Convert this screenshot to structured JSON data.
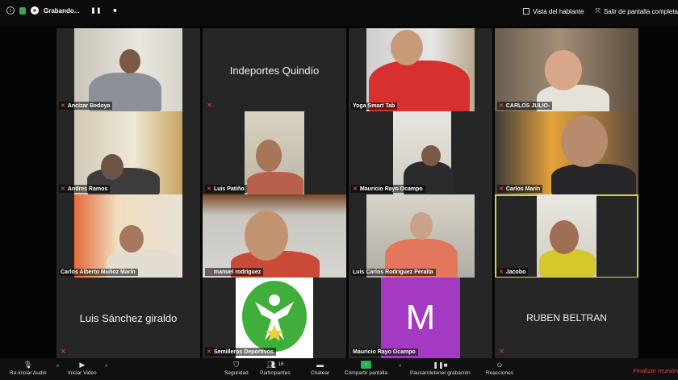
{
  "topbar": {
    "recording_label": "Grabando...",
    "pause_icon": "pause-icon",
    "stop_icon": "stop-icon",
    "speaker_view": "Vista del hablante",
    "exit_fullscreen": "Salir de pantalla completa"
  },
  "tiles": [
    {
      "label": "Ancízar Bedoya"
    },
    {
      "big": "Indeportes Quindío"
    },
    {
      "label": "Yoga Smart Tab"
    },
    {
      "label": "CARLOS JULIO-"
    },
    {
      "label": "Andres Ramos"
    },
    {
      "label": "Luis Patiño"
    },
    {
      "label": "Mauricio Rayo Ocampo"
    },
    {
      "label": "Carlos Marín"
    },
    {
      "label": "Carlos Alberto Muñoz Marín"
    },
    {
      "label": "manuel rodriguez"
    },
    {
      "label": "Luis Carlos Rodríguez Peralta"
    },
    {
      "label": "Jacobo"
    },
    {
      "big": "Luis Sánchez giraldo"
    },
    {
      "label": "Semilleros Deportivos"
    },
    {
      "label": "Mauricio Rayo Ocampo",
      "avatar_letter": "M"
    },
    {
      "big": "RUBEN BELTRAN"
    }
  ],
  "bottombar": {
    "audio": "Re-iniciar Audio",
    "video": "Iniciar Video",
    "security": "Seguridad",
    "participants": "Participantes",
    "participants_count": "16",
    "chat": "Chatear",
    "share": "Compartir pantalla",
    "record": "Pausar/detener grabación",
    "reactions": "Reacciones",
    "end": "Finalizar reunión"
  },
  "colors": {
    "background": "#050505",
    "tile": "#262626",
    "active_border": "#c9d64a",
    "muted": "#e4473c",
    "avatar_purple": "#a43ac1",
    "share_green": "#26b35a"
  }
}
